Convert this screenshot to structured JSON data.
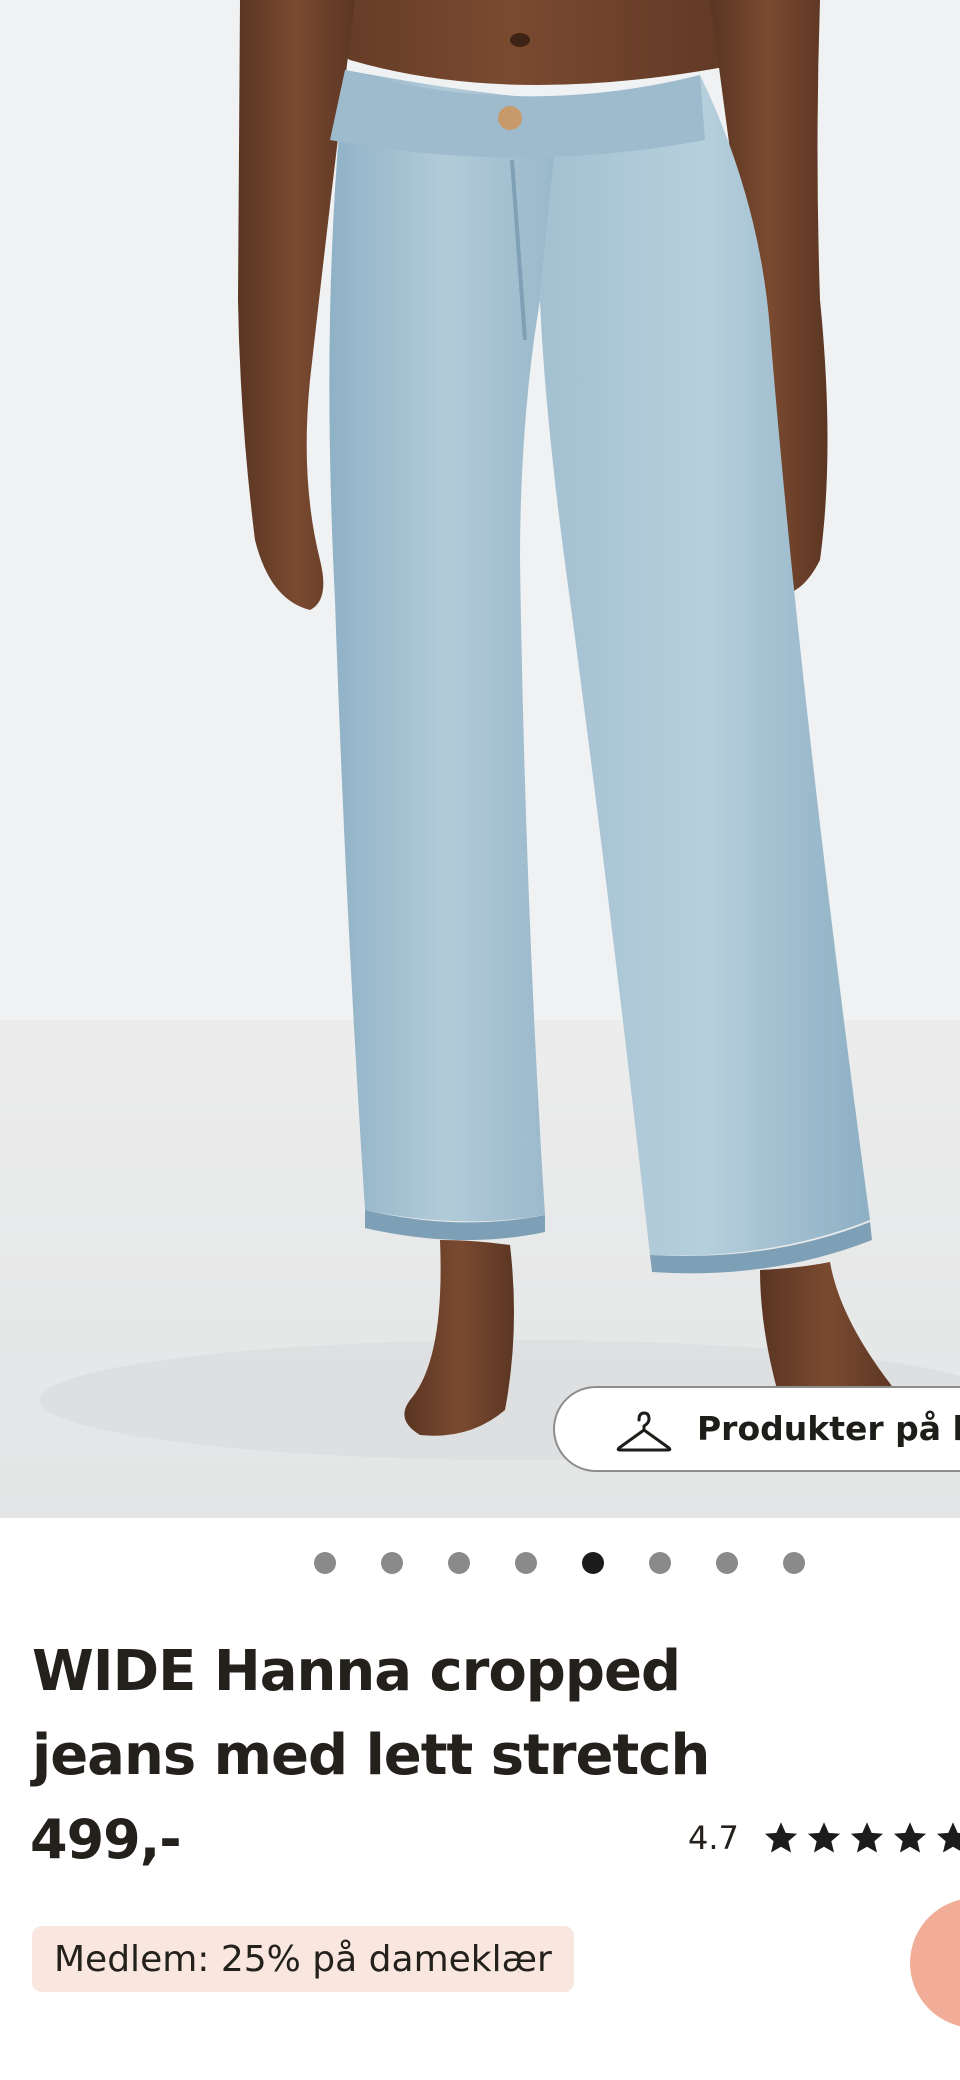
{
  "gallery": {
    "products_button_label": "Produkter på bildet",
    "dot_count": 8,
    "active_dot_index": 4
  },
  "product": {
    "title": "WIDE Hanna cropped jeans med lett stretch",
    "price": "499,-",
    "rating_value": "4.7",
    "rating_stars": 5,
    "member_offer": "Medlem: 25% på dameklær"
  },
  "colors": {
    "denim": "#a9c4d4",
    "member_badge_bg": "#f9e6df",
    "fab": "#f2ad99",
    "text": "#24211c"
  },
  "icons": [
    "hanger-icon",
    "star-icon"
  ]
}
